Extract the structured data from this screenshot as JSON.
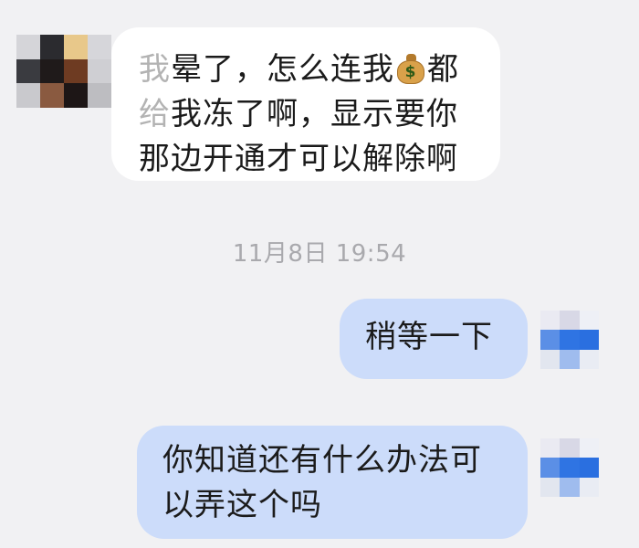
{
  "conversation": {
    "incoming": {
      "lines": [
        {
          "faded_char": "我",
          "text_before_icon": "晕了，怎么连我",
          "icon": "money-bag-icon",
          "text_after_icon": "都"
        },
        {
          "faded_char": "给",
          "text": "我冻了啊，显示要你"
        },
        {
          "text": "那边开通才可以解除啊"
        }
      ],
      "money_icon_symbol": "$"
    },
    "timestamp": "11月8日 19:54",
    "outgoing": [
      {
        "lines": [
          "稍等一下"
        ]
      },
      {
        "lines": [
          "你知道还有什么办法可",
          "以弄这个吗"
        ]
      }
    ]
  },
  "avatars": {
    "left_pixels": [
      "#d5d5d9",
      "#2b2b2f",
      "#e8c88a",
      "#d6d6da",
      "#3a3b40",
      "#1f1a1a",
      "#6e3b22",
      "#cfcfd3",
      "#c9c9cd",
      "#8a5a40",
      "#1d1616",
      "#bdbdc1"
    ],
    "right_pixels": [
      "#eaeaf2",
      "#d8d8e6",
      "#eef0f6",
      "#5b8fe6",
      "#2f74e3",
      "#2a6fe0",
      "#e2e6ef",
      "#9fbcee",
      "#e9ecf3"
    ]
  },
  "colors": {
    "background": "#f1f1f3",
    "incoming_bubble": "#ffffff",
    "outgoing_bubble": "#ccdcfa",
    "timestamp_text": "#a9a9ad"
  }
}
